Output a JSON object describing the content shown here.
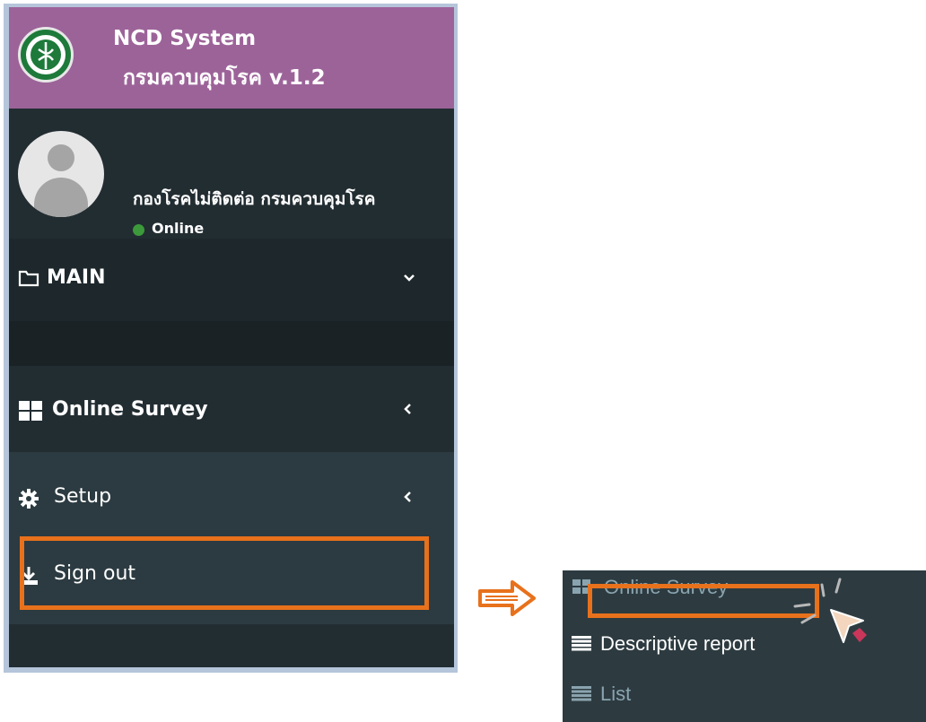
{
  "brand": {
    "title": "NCD System",
    "subtitle": "กรมควบคุมโรค  v.1.2"
  },
  "user": {
    "name": "กองโรคไม่ติดต่อ กรมควบคุมโรค",
    "status": "Online"
  },
  "menu": {
    "main_label": "MAIN",
    "items": [
      {
        "label": "Online Survey",
        "icon": "grid-icon"
      },
      {
        "label": "Setup",
        "icon": "gear-icon"
      },
      {
        "label": "Sign out",
        "icon": "download-icon"
      }
    ]
  },
  "zoomed_menu": {
    "items": [
      {
        "label": "Online Survey",
        "icon": "grid-icon"
      },
      {
        "label": "Descriptive report",
        "icon": "list-icon"
      },
      {
        "label": "List",
        "icon": "list-icon"
      }
    ]
  },
  "colors": {
    "brand_bg": "#9c6399",
    "sidebar_bg": "#222d32",
    "highlight": "#e8711c",
    "online": "#3c9a3b"
  }
}
